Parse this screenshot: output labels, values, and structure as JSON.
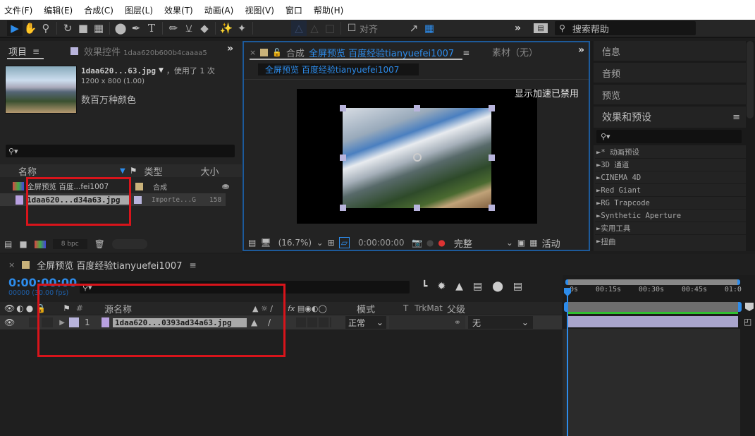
{
  "menubar": {
    "items": [
      "文件(F)",
      "编辑(E)",
      "合成(C)",
      "图层(L)",
      "效果(T)",
      "动画(A)",
      "视图(V)",
      "窗口",
      "帮助(H)"
    ]
  },
  "toolbar": {
    "tools": [
      "selection-tool",
      "hand-tool",
      "zoom-tool",
      "rotate-tool",
      "camera-tool",
      "pan-behind-tool",
      "ellipse-tool",
      "pen-tool",
      "type-tool",
      "brush-tool",
      "clone-stamp-tool",
      "eraser-tool",
      "roto-brush-tool",
      "puppet-pin-tool"
    ],
    "align_label": "对齐",
    "overflow": "»",
    "search_placeholder": "搜索帮助"
  },
  "project_panel": {
    "tab_label": "项目",
    "effects_tab_label": "效果控件",
    "effects_tab_file": "1daa620b600b4caaaa5",
    "overflow": "»",
    "preview": {
      "file_name": "1daa620...63.jpg",
      "usage": "，使用了 1 次",
      "dimensions": "1200 x 800 (1.00)",
      "color_info": "数百万种颜色"
    },
    "search_placeholder": "",
    "columns": {
      "name": "名称",
      "type": "类型",
      "size": "大小"
    },
    "items": [
      {
        "name": "全屏预览 百度...fei1007",
        "type": "合成",
        "size": "",
        "label_color": "#c9b27a"
      },
      {
        "name": "1daa620...d34a63.jpg",
        "type": "Importe...G",
        "size": "158",
        "label_color": "#b8b4dc"
      }
    ],
    "bpc": "8 bpc"
  },
  "composition_panel": {
    "close": "×",
    "tab_prefix": "合成",
    "tab_name": "全屏预览 百度经验tianyuefei1007",
    "footage_tab": "素材（无）",
    "overflow": "»",
    "breadcrumb": "全屏预览 百度经验tianyuefei1007",
    "accel_notice": "显示加速已禁用",
    "zoom": "(16.7%)",
    "timecode": "0:00:00:00",
    "resolution": "完整",
    "camera": "活动"
  },
  "right_panel": {
    "sections": [
      "信息",
      "音频",
      "预览"
    ],
    "effects_title": "效果和预设",
    "effects": [
      "* 动画预设",
      "3D 通道",
      "CINEMA 4D",
      "Red Giant",
      "RG Trapcode",
      "Synthetic Aperture",
      "实用工具",
      "扭曲"
    ]
  },
  "timeline": {
    "close": "×",
    "comp_name": "全屏预览 百度经验tianyuefei1007",
    "timecode": "0:00:00:00",
    "frame_info": "00000 (30.00 fps)",
    "columns": {
      "source_name": "源名称",
      "mode": "模式",
      "trkmat_t": "T",
      "trkmat": "TrkMat",
      "parent": "父级"
    },
    "layers": [
      {
        "number": "1",
        "name": "1daa620...0393ad34a63.jpg",
        "mode": "正常",
        "parent": "无",
        "label_color": "#b8b4dc"
      }
    ],
    "ruler": [
      "0s",
      "00:15s",
      "00:30s",
      "00:45s",
      "01:0"
    ]
  },
  "colors": {
    "accent": "#2d8ceb",
    "highlight_box": "#d8141b",
    "layer_bar": "#a9a5cc",
    "work_area": "#30c030"
  }
}
